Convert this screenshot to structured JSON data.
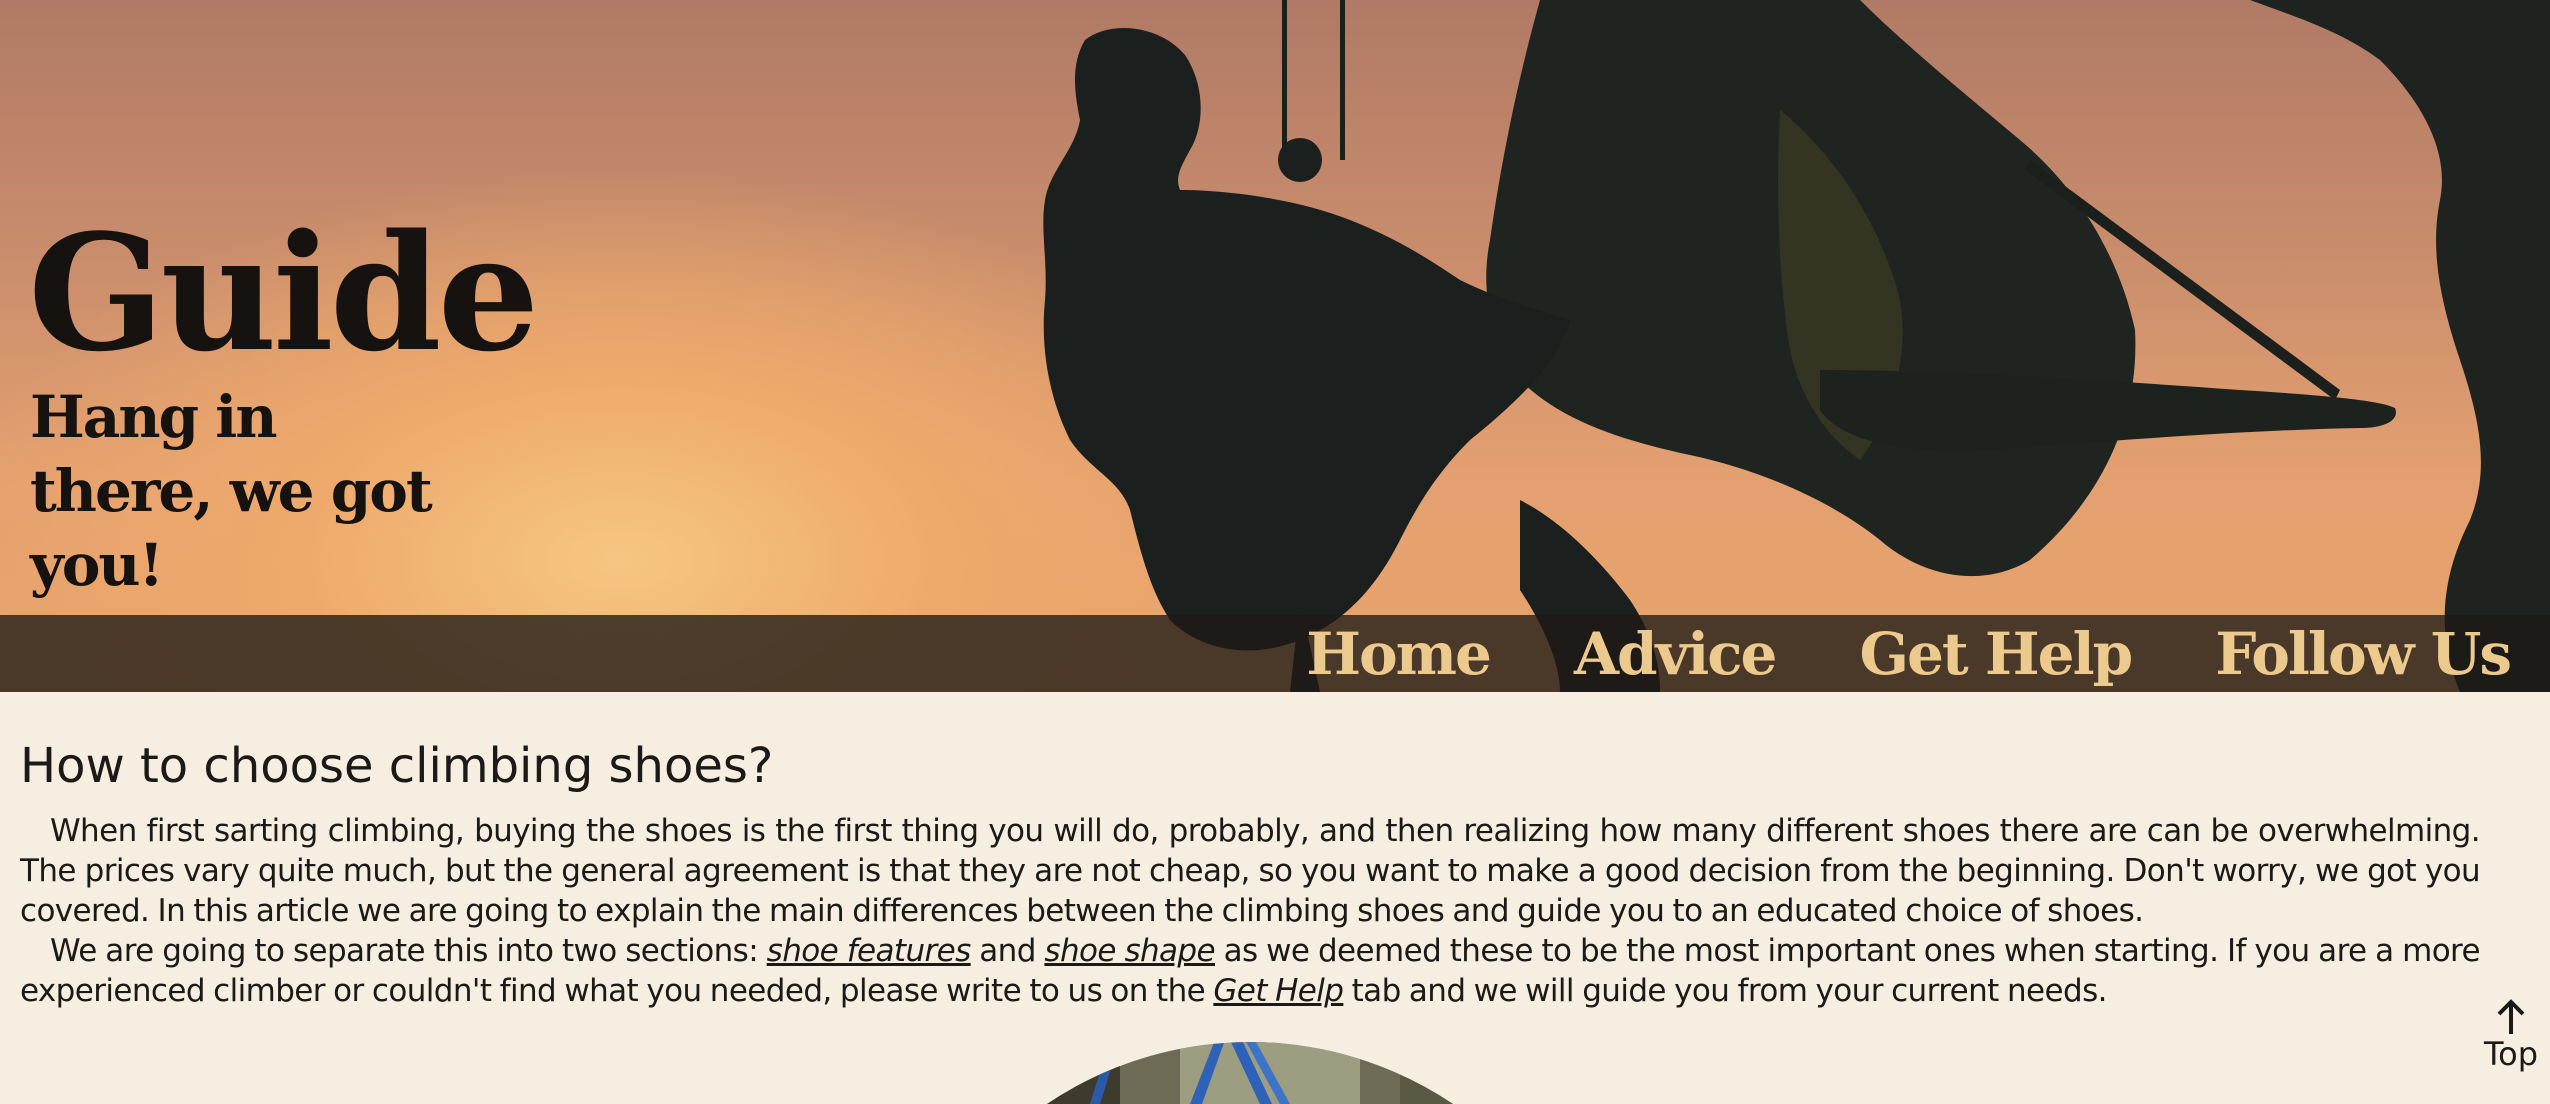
{
  "hero": {
    "title": "Guide",
    "subtitle": "Hang in there, we got you!",
    "image": "climber-silhouette-sunset"
  },
  "nav": {
    "items": [
      {
        "label": "Home"
      },
      {
        "label": "Advice"
      },
      {
        "label": "Get Help"
      },
      {
        "label": "Follow Us"
      }
    ]
  },
  "article": {
    "title": "How to choose climbing shoes?",
    "p1": "When first sarting climbing, buying the shoes is the first thing you will do, probably, and then realizing how many different shoes there are can be overwhelming. The prices vary quite much, but the general agreement is that they are not cheap, so you want to make a good decision from the beginning. Don't worry, we got you covered. In this article we are going to explain the main differences between the climbing shoes and guide you to an educated choice of shoes.",
    "p2": {
      "before": "We are going to separate this into two sections: ",
      "link1": "shoe features",
      "mid1": " and ",
      "link2": "shoe shape",
      "mid2": " as we deemed these to be the most important ones when starting. If you are a more experienced climber or couldn't find what you needed, please write to us on the ",
      "link3": "Get Help",
      "after": " tab and we will guide you from your current needs."
    }
  },
  "top_button": {
    "label": "Top",
    "icon": "arrow-up-icon"
  },
  "colors": {
    "background": "#f6efe1",
    "nav_bar": "#1e1a16",
    "nav_text": "#ecc98d",
    "text": "#1c1a17"
  }
}
